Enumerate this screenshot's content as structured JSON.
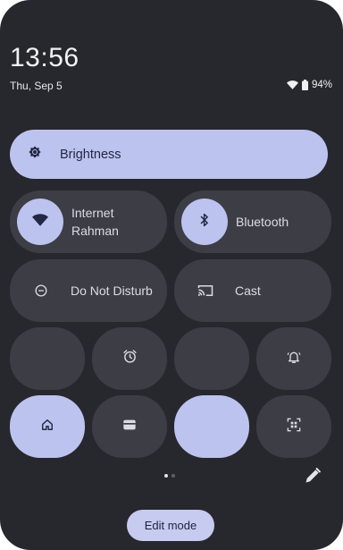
{
  "header": {
    "time": "13:56",
    "date": "Thu, Sep 5",
    "battery_percent": "94%"
  },
  "brightness": {
    "label": "Brightness",
    "icon": "brightness-icon"
  },
  "tiles": {
    "internet": {
      "title": "Internet",
      "subtitle": "Rahman",
      "icon": "wifi-icon",
      "active": true
    },
    "bluetooth": {
      "title": "Bluetooth",
      "icon": "bluetooth-icon",
      "active": true
    },
    "dnd": {
      "title": "Do Not Disturb",
      "icon": "do-not-disturb-icon",
      "active": false
    },
    "cast": {
      "title": "Cast",
      "icon": "cast-icon",
      "active": false
    },
    "small_row1": [
      {
        "icon": "",
        "active": false
      },
      {
        "icon": "alarm-icon",
        "active": false
      },
      {
        "icon": "",
        "active": false
      },
      {
        "icon": "vibrate-bell-icon",
        "active": false
      }
    ],
    "small_row2": [
      {
        "icon": "home-icon",
        "active": true
      },
      {
        "icon": "wallet-icon",
        "active": false
      },
      {
        "icon": "",
        "active": true
      },
      {
        "icon": "qr-scanner-icon",
        "active": false
      }
    ]
  },
  "pager": {
    "pages": 2,
    "current": 1
  },
  "footer": {
    "edit_label": "Edit mode"
  },
  "colors": {
    "panel": "#27272e",
    "tile": "#3d3d46",
    "accent": "#bcc3ef"
  }
}
